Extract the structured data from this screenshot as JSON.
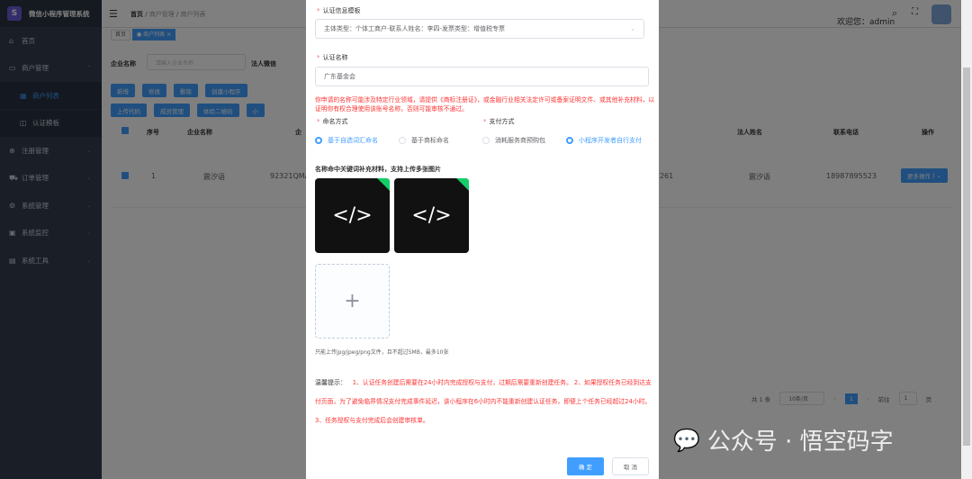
{
  "app": {
    "title": "微信小程序管理系统",
    "logo_glyph": "S"
  },
  "sidebar": {
    "items": [
      {
        "icon": "dashboard-icon",
        "glyph": "⌂",
        "label": "首页"
      },
      {
        "icon": "store-icon",
        "glyph": "▭",
        "label": "商户管理",
        "expanded": true
      },
      {
        "icon": "list-icon",
        "glyph": "▦",
        "label": "商户列表",
        "sub": true,
        "active": true
      },
      {
        "icon": "template-icon",
        "glyph": "◫",
        "label": "认证模板",
        "sub": true
      },
      {
        "icon": "register-icon",
        "glyph": "⊕",
        "label": "注册管理"
      },
      {
        "icon": "cart-icon",
        "glyph": "⛟",
        "label": "订单管理"
      },
      {
        "icon": "gear-icon",
        "glyph": "⚙",
        "label": "系统管理"
      },
      {
        "icon": "monitor-icon",
        "glyph": "▣",
        "label": "系统监控"
      },
      {
        "icon": "tool-icon",
        "glyph": "▤",
        "label": "系统工具"
      }
    ]
  },
  "header": {
    "breadcrumb": [
      "首页",
      "商户管理",
      "商户列表"
    ],
    "welcome": "欢迎您：admin"
  },
  "tags": [
    "首页",
    "商户列表"
  ],
  "search": {
    "company_label": "企业名称",
    "company_placeholder": "请输入企业名称",
    "legal_label": "法人微信"
  },
  "toolbar": {
    "row1": [
      "新增",
      "修改",
      "删除",
      "创建小程序"
    ],
    "row2": [
      "上传代码",
      "成员管理",
      "体验二维码",
      "小"
    ]
  },
  "table": {
    "headers": [
      "序号",
      "企业名称",
      "企",
      "法人姓名",
      "联系电话",
      "操作"
    ],
    "rows": [
      {
        "index": "1",
        "company": "震汐语",
        "code": "92321QMA",
        "code_tail": "261",
        "legal": "震汐语",
        "phone": "18987895523",
        "action": "更多操作"
      }
    ]
  },
  "pagination": {
    "total": "共 1 条",
    "page_size": "10条/页",
    "current": "1",
    "goto_label": "前往",
    "goto_value": "1",
    "page_unit": "页"
  },
  "watermark": "公众号 · 悟空码字",
  "modal": {
    "template_label": "认证信息模板",
    "template_value": "主体类型：个体工商户-联系人姓名：李四-发票类型：增值税专票",
    "name_label": "认证名称",
    "name_value": "广东基金会",
    "warning": "你申请的名称可能涉及特定行业领域，请提供《商标注册证》，或金融行业相关法定许可或备案证明文件、或其他补充材料，以证明你有权合理使用该账号名称，否则可能审核不通过。",
    "naming_label": "命名方式",
    "naming_options": [
      "基于自选词汇命名",
      "基于商标命名"
    ],
    "naming_selected": 0,
    "pay_label": "支付方式",
    "pay_options": [
      "消耗服务商预购包",
      "小程序开发者自行支付"
    ],
    "pay_selected": 1,
    "materials_label": "名称命中关键词补充材料，支持上传多张图片",
    "image_glyph": "</>",
    "upload_glyph": "+",
    "upload_hint": "只能上传jpg/jpeg/png文件，且不超过5MB，最多10张",
    "tips_label": "温馨提示：",
    "tips_text": "1、认证任务创建后需要在24小时内完成授权与支付，过期后需要重新创建任务。 2、如果授权任务已经到达支付页面，为了避免临界情况支付完成事件延迟，该小程序在6小时内不能重新创建认证任务，即便上个任务已经超过24小时。 3、任务授权与支付完成后会创建审核单。",
    "confirm": "确 定",
    "cancel": "取 消"
  },
  "colors": {
    "primary": "#409eff",
    "danger": "#f33"
  }
}
